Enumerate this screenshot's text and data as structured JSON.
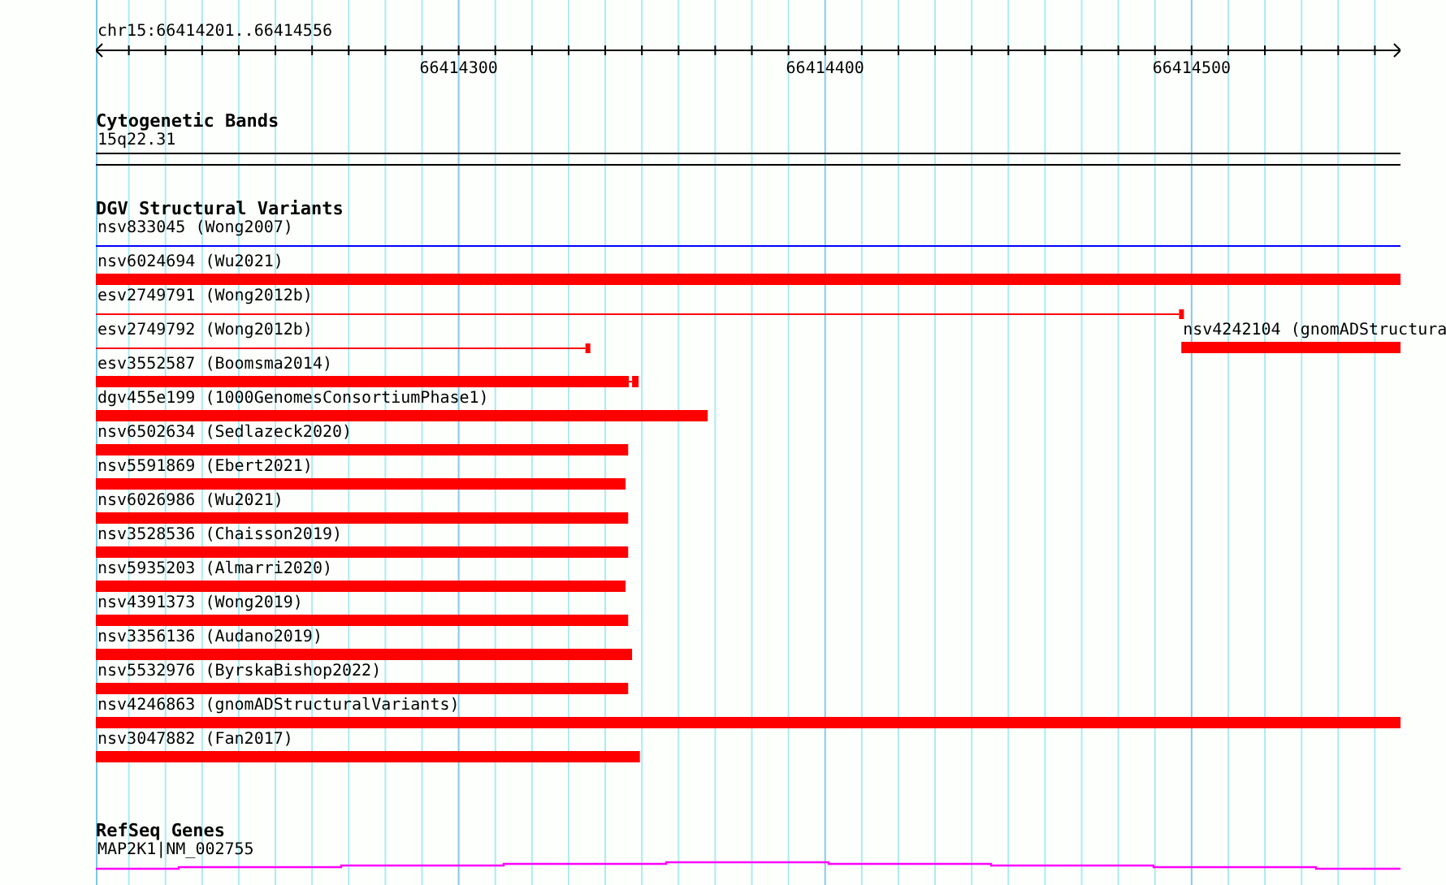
{
  "ruler": {
    "location": "chr15:66414201..66414556",
    "ticks": [
      "66414300",
      "66414400",
      "66414500"
    ]
  },
  "tracks": [
    {
      "kind": "cytoband",
      "title": "Cytogenetic Bands",
      "features": [
        {
          "label": "15q22.31"
        }
      ]
    },
    {
      "kind": "variants",
      "title": "DGV Structural Variants",
      "rows": [
        {
          "features": [
            {
              "label": "nsv833045 (Wong2007)",
              "kind": "thin",
              "color": "#0000ff",
              "level": 1
            }
          ]
        },
        {
          "features": [
            {
              "label": "nsv6024694 (Wu2021)",
              "kind": "thick",
              "color": "#ff0000",
              "level": 1
            }
          ]
        },
        {
          "features": [
            {
              "label": "esv2749791 (Wong2012b)",
              "kind": "thin-end",
              "color": "#ff0000",
              "level": 0.834
            }
          ]
        },
        {
          "features": [
            {
              "label": "esv2749792 (Wong2012b)",
              "kind": "thin-end",
              "color": "#ff0000",
              "level": 0.379
            },
            {
              "label": "nsv4242104 (gnomADStructura",
              "kind": "thick-right",
              "color": "#ff0000",
              "level": 0.168
            }
          ]
        },
        {
          "features": [
            {
              "label": "esv3552587 (Boomsma2014)",
              "kind": "thick-end",
              "color": "#ff0000",
              "level": 0.416
            }
          ]
        },
        {
          "features": [
            {
              "label": "dgv455e199 (1000GenomesConsortiumPhase1)",
              "kind": "thick",
              "color": "#ff0000",
              "level": 0.469
            }
          ]
        },
        {
          "features": [
            {
              "label": "nsv6502634 (Sedlazeck2020)",
              "kind": "thick",
              "color": "#ff0000",
              "level": 0.408
            }
          ]
        },
        {
          "features": [
            {
              "label": "nsv5591869 (Ebert2021)",
              "kind": "thick",
              "color": "#ff0000",
              "level": 0.406
            }
          ]
        },
        {
          "features": [
            {
              "label": "nsv6026986 (Wu2021)",
              "kind": "thick",
              "color": "#ff0000",
              "level": 0.408
            }
          ]
        },
        {
          "features": [
            {
              "label": "nsv3528536 (Chaisson2019)",
              "kind": "thick",
              "color": "#ff0000",
              "level": 0.408
            }
          ]
        },
        {
          "features": [
            {
              "label": "nsv5935203 (Almarri2020)",
              "kind": "thick",
              "color": "#ff0000",
              "level": 0.406
            }
          ]
        },
        {
          "features": [
            {
              "label": "nsv4391373 (Wong2019)",
              "kind": "thick",
              "color": "#ff0000",
              "level": 0.408
            }
          ]
        },
        {
          "features": [
            {
              "label": "nsv3356136 (Audano2019)",
              "kind": "thick",
              "color": "#ff0000",
              "level": 0.411
            }
          ]
        },
        {
          "features": [
            {
              "label": "nsv5532976 (ByrskaBishop2022)",
              "kind": "thick",
              "color": "#ff0000",
              "level": 0.408
            }
          ]
        },
        {
          "features": [
            {
              "label": "nsv4246863 (gnomADStructuralVariants)",
              "kind": "thick",
              "color": "#ff0000",
              "level": 1
            }
          ]
        },
        {
          "features": [
            {
              "label": "nsv3047882 (Fan2017)",
              "kind": "thick",
              "color": "#ff0000",
              "level": 0.417
            }
          ]
        }
      ]
    },
    {
      "kind": "gene",
      "title": "RefSeq Genes",
      "features": [
        {
          "label": "MAP2K1|NM_002755"
        }
      ]
    }
  ]
}
